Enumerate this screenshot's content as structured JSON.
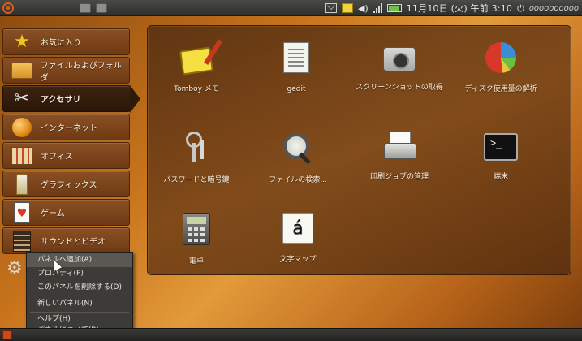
{
  "top_panel": {
    "clock": "11月10日 (火) 午前 3:10",
    "user": "oooooooooo",
    "icons": [
      "ubuntu-logo",
      "window-icon",
      "window-icon",
      "mail-icon",
      "note-icon",
      "volume-icon",
      "signal-icon",
      "battery-icon",
      "power-icon"
    ]
  },
  "sidebar": {
    "items": [
      {
        "label": "お気に入り",
        "icon": "star-icon",
        "glyph": "★",
        "color": "#f2c51a"
      },
      {
        "label": "ファイルおよびフォルダ",
        "icon": "folder-icon",
        "glyph": "",
        "color": "#e8a632"
      },
      {
        "label": "アクセサリ",
        "icon": "tools-icon",
        "glyph": "✂",
        "color": "#e0e0dc",
        "active": true
      },
      {
        "label": "インターネット",
        "icon": "globe-icon",
        "glyph": "●",
        "color": "#e89a1e"
      },
      {
        "label": "オフィス",
        "icon": "office-icon",
        "glyph": "▦",
        "color": "#d8c08a"
      },
      {
        "label": "グラフィックス",
        "icon": "graphics-icon",
        "glyph": "▲",
        "color": "#e8d8a8"
      },
      {
        "label": "ゲーム",
        "icon": "cards-icon",
        "glyph": "♥",
        "color": "#d8382a"
      },
      {
        "label": "サウンドとビデオ",
        "icon": "film-icon",
        "glyph": "▥",
        "color": "#c8a47a"
      }
    ]
  },
  "apps": [
    {
      "label": "Tomboy メモ",
      "icon": "tomboy-icon"
    },
    {
      "label": "gedit",
      "icon": "gedit-icon"
    },
    {
      "label": "スクリーンショットの取得",
      "icon": "camera-icon"
    },
    {
      "label": "ディスク使用量の解析",
      "icon": "disk-usage-icon"
    },
    {
      "label": "パスワードと暗号鍵",
      "icon": "keys-icon"
    },
    {
      "label": "ファイルの検索...",
      "icon": "search-icon"
    },
    {
      "label": "印刷ジョブの管理",
      "icon": "printer-icon"
    },
    {
      "label": "端末",
      "icon": "terminal-icon",
      "glyph": ">_"
    },
    {
      "label": "電卓",
      "icon": "calculator-icon"
    },
    {
      "label": "文字マップ",
      "icon": "charmap-icon",
      "glyph": "á"
    }
  ],
  "context_menu": {
    "items": [
      {
        "label": "パネルへ追加(A)...",
        "hovered": true
      },
      {
        "label": "プロパティ(P)"
      },
      {
        "label": "このパネルを削除する(D)"
      },
      {
        "label": "新しいパネル(N)"
      },
      {
        "label": "ヘルプ(H)"
      },
      {
        "label": "パネルについて(B)"
      }
    ]
  },
  "colors": {
    "accent": "#e05a1c",
    "panel_bg": "#3c3b37",
    "background": "#c8741c"
  }
}
